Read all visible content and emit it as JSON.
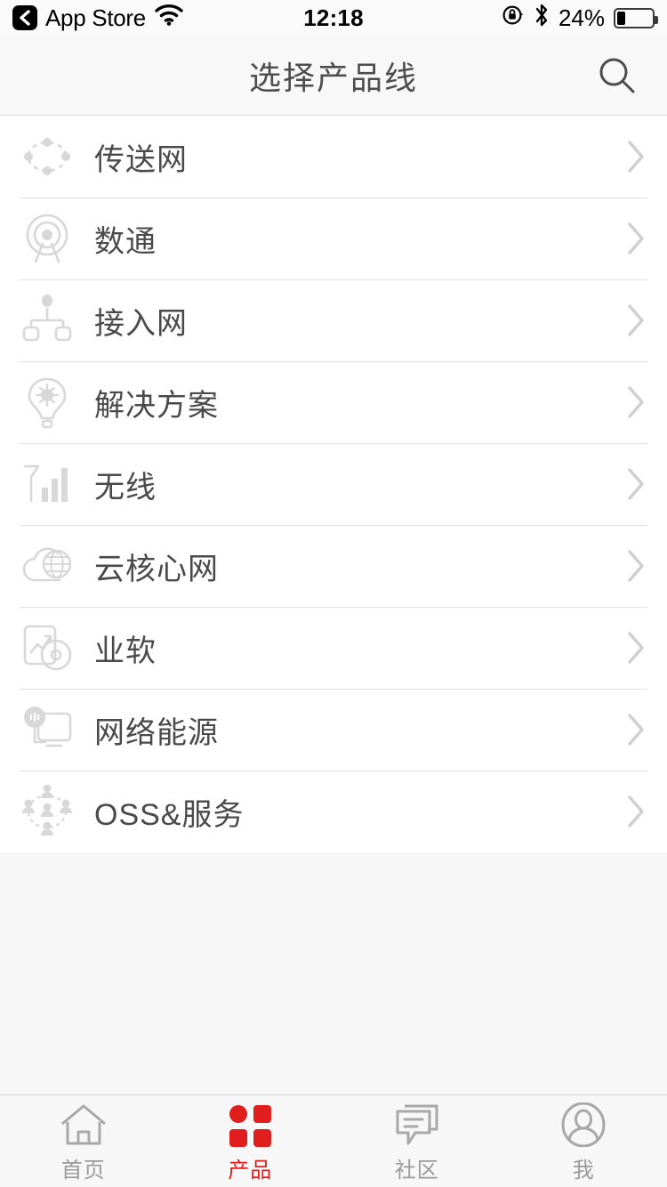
{
  "statusbar": {
    "back_icon": "back-chevron-icon",
    "app_name": "App Store",
    "wifi_icon": "wifi-icon",
    "time": "12:18",
    "rotation_lock_icon": "rotation-lock-icon",
    "bluetooth_icon": "bluetooth-icon",
    "battery_percent": "24%",
    "battery_level": 24
  },
  "header": {
    "title": "选择产品线",
    "search_icon": "search-icon"
  },
  "list": {
    "items": [
      {
        "label": "传送网",
        "icon": "transport-network-icon",
        "chevron": "chevron-right-icon"
      },
      {
        "label": "数通",
        "icon": "datacom-antenna-icon",
        "chevron": "chevron-right-icon"
      },
      {
        "label": "接入网",
        "icon": "access-network-icon",
        "chevron": "chevron-right-icon"
      },
      {
        "label": "解决方案",
        "icon": "lightbulb-icon",
        "chevron": "chevron-right-icon"
      },
      {
        "label": "无线",
        "icon": "signal-bars-icon",
        "chevron": "chevron-right-icon"
      },
      {
        "label": "云核心网",
        "icon": "cloud-globe-icon",
        "chevron": "chevron-right-icon"
      },
      {
        "label": "业软",
        "icon": "chart-disc-icon",
        "chevron": "chevron-right-icon"
      },
      {
        "label": "网络能源",
        "icon": "power-monitor-icon",
        "chevron": "chevron-right-icon"
      },
      {
        "label": "OSS&服务",
        "icon": "people-network-icon",
        "chevron": "chevron-right-icon"
      }
    ]
  },
  "tabbar": {
    "active_color": "#e01e1e",
    "inactive_color": "#9a9a9a",
    "tabs": [
      {
        "label": "首页",
        "icon": "home-icon",
        "active": false
      },
      {
        "label": "产品",
        "icon": "grid-icon",
        "active": true
      },
      {
        "label": "社区",
        "icon": "chat-icon",
        "active": false
      },
      {
        "label": "我",
        "icon": "person-icon",
        "active": false
      }
    ]
  }
}
